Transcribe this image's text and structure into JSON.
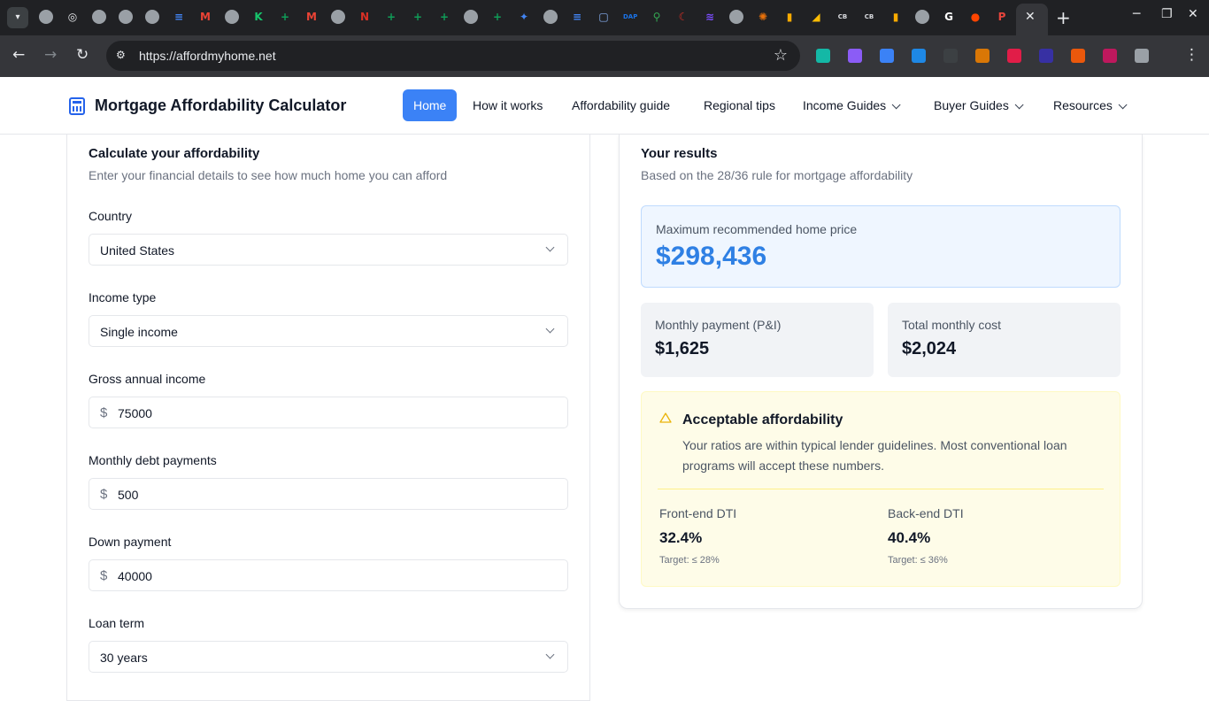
{
  "browser": {
    "tab_icons": [
      {
        "name": "globe-icon",
        "letter": "",
        "color": "#9aa0a6"
      },
      {
        "name": "openai-icon",
        "letter": "◎",
        "color": "#e8eaed"
      },
      {
        "name": "globe-icon",
        "letter": "",
        "color": "#9aa0a6"
      },
      {
        "name": "globe-icon",
        "letter": "",
        "color": "#9aa0a6"
      },
      {
        "name": "globe-icon",
        "letter": "",
        "color": "#9aa0a6"
      },
      {
        "name": "docs-icon",
        "letter": "≡",
        "color": "#4285f4"
      },
      {
        "name": "gmail-icon",
        "letter": "M",
        "color": "#ea4335"
      },
      {
        "name": "globe-icon",
        "letter": "",
        "color": "#9aa0a6"
      },
      {
        "name": "k-icon",
        "letter": "K",
        "color": "#16c66c"
      },
      {
        "name": "sheets-icon",
        "letter": "+",
        "color": "#0f9d58"
      },
      {
        "name": "gmail-icon",
        "letter": "M",
        "color": "#ea4335"
      },
      {
        "name": "globe-icon",
        "letter": "",
        "color": "#9aa0a6"
      },
      {
        "name": "script-icon",
        "letter": "N",
        "color": "#d93025"
      },
      {
        "name": "sheets-icon",
        "letter": "+",
        "color": "#0f9d58"
      },
      {
        "name": "sheets-icon",
        "letter": "+",
        "color": "#0f9d58"
      },
      {
        "name": "sheets-icon",
        "letter": "+",
        "color": "#0f9d58"
      },
      {
        "name": "globe-icon",
        "letter": "",
        "color": "#9aa0a6"
      },
      {
        "name": "sheets-icon",
        "letter": "+",
        "color": "#0f9d58"
      },
      {
        "name": "gemini-icon",
        "letter": "✦",
        "color": "#4285f4"
      },
      {
        "name": "globe-icon",
        "letter": "",
        "color": "#9aa0a6"
      },
      {
        "name": "docs-icon",
        "letter": "≡",
        "color": "#4285f4"
      },
      {
        "name": "screen-icon",
        "letter": "▢",
        "color": "#8ab4f8"
      },
      {
        "name": "dap-icon",
        "letter": "DAP",
        "color": "#1a73e8"
      },
      {
        "name": "maps-icon",
        "letter": "⚲",
        "color": "#34a853"
      },
      {
        "name": "moon-icon",
        "letter": "☾",
        "color": "#d93025"
      },
      {
        "name": "stack-icon",
        "letter": "≋",
        "color": "#7c4dff"
      },
      {
        "name": "globe-icon",
        "letter": "",
        "color": "#9aa0a6"
      },
      {
        "name": "burst-icon",
        "letter": "✺",
        "color": "#e8710a"
      },
      {
        "name": "analytics-icon",
        "letter": "▮",
        "color": "#f9ab00"
      },
      {
        "name": "ads-icon",
        "letter": "◢",
        "color": "#fbbc04"
      },
      {
        "name": "cb-icon",
        "letter": "CB",
        "color": "#dadce0"
      },
      {
        "name": "cb-icon",
        "letter": "CB",
        "color": "#dadce0"
      },
      {
        "name": "chart-icon",
        "letter": "▮",
        "color": "#f9ab00"
      },
      {
        "name": "globe-icon",
        "letter": "",
        "color": "#9aa0a6"
      },
      {
        "name": "google-icon",
        "letter": "G",
        "color": "#ffffff"
      },
      {
        "name": "reddit-icon",
        "letter": "●",
        "color": "#ff4500"
      },
      {
        "name": "p-icon",
        "letter": "P",
        "color": "#e8453c"
      }
    ],
    "active_tab_close": "✕",
    "new_tab": "+",
    "url": "https://affordmyhome.net",
    "extension_colors": [
      "#14b8a6",
      "#8b5cf6",
      "#3b82f6",
      "#1e88e5",
      "#3c4043",
      "#d97706",
      "#e11d48",
      "#3730a3",
      "#ea580c",
      "#be185d",
      "#9aa0a6"
    ]
  },
  "site": {
    "title": "Mortgage Affordability Calculator",
    "nav": {
      "home": "Home",
      "how": "How it works",
      "guide": "Affordability guide",
      "regional": "Regional tips",
      "income": "Income Guides",
      "buyer": "Buyer Guides",
      "resources": "Resources"
    }
  },
  "form": {
    "title": "Calculate your affordability",
    "subtitle": "Enter your financial details to see how much home you can afford",
    "country_label": "Country",
    "country_value": "United States",
    "income_type_label": "Income type",
    "income_type_value": "Single income",
    "gross_income_label": "Gross annual income",
    "gross_income_value": "75000",
    "monthly_debt_label": "Monthly debt payments",
    "monthly_debt_value": "500",
    "down_payment_label": "Down payment",
    "down_payment_value": "40000",
    "loan_term_label": "Loan term",
    "loan_term_value": "30 years",
    "currency_symbol": "$"
  },
  "results": {
    "title": "Your results",
    "subtitle": "Based on the 28/36 rule for mortgage affordability",
    "max_price_label": "Maximum recommended home price",
    "max_price_value": "$298,436",
    "monthly_payment_label": "Monthly payment (P&I)",
    "monthly_payment_value": "$1,625",
    "total_monthly_label": "Total monthly cost",
    "total_monthly_value": "$2,024",
    "status_title": "Acceptable affordability",
    "status_text": "Your ratios are within typical lender guidelines. Most conventional loan programs will accept these numbers.",
    "front_dti_label": "Front-end DTI",
    "front_dti_value": "32.4%",
    "front_dti_target": "Target: ≤ 28%",
    "back_dti_label": "Back-end DTI",
    "back_dti_value": "40.4%",
    "back_dti_target": "Target: ≤ 36%"
  },
  "colors": {
    "accent": "#3b82f6",
    "price": "#2f80e4",
    "warning_bg": "#fefce8",
    "warning_icon": "#eab308"
  }
}
